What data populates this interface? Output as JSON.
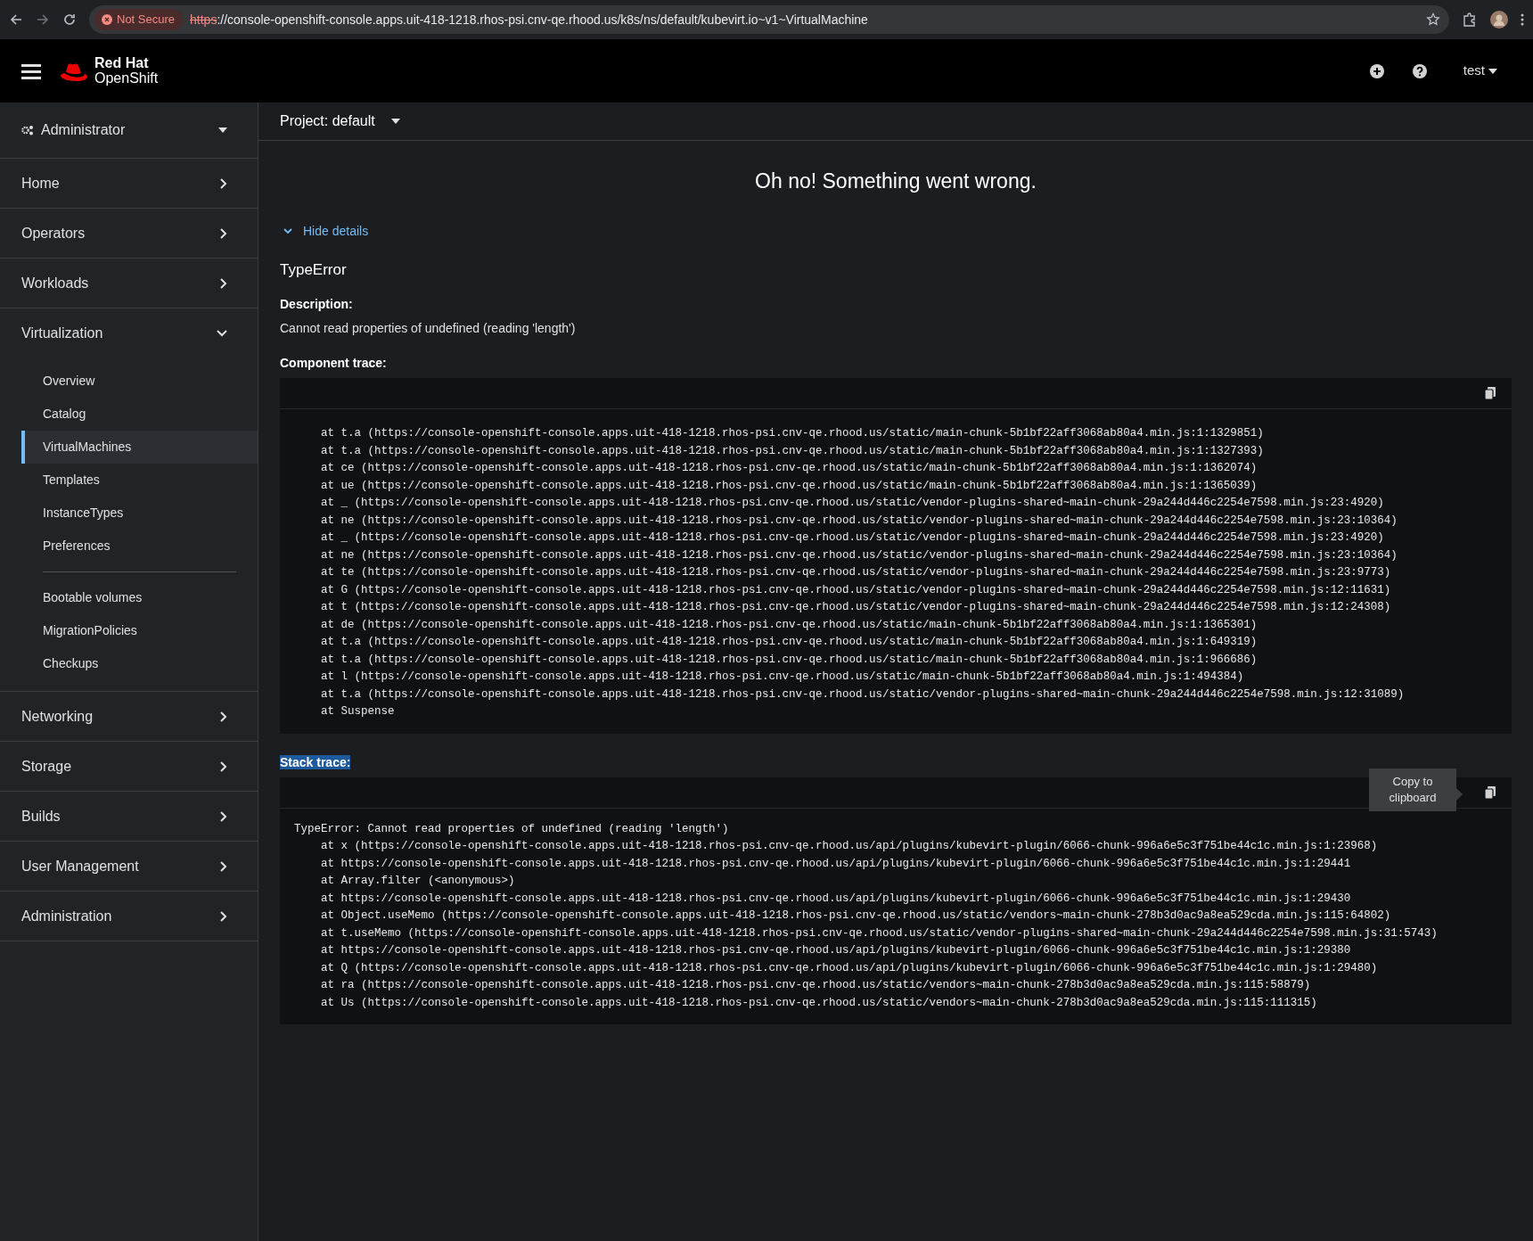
{
  "browser": {
    "security_badge": "Not Secure",
    "url_scheme": "https",
    "url_rest": "://console-openshift-console.apps.uit-418-1218.rhos-psi.cnv-qe.rhood.us/k8s/ns/default/kubevirt.io~v1~VirtualMachine"
  },
  "masthead": {
    "brand_top": "Red Hat",
    "brand_bottom": "OpenShift",
    "user": "test"
  },
  "sidebar": {
    "perspective": "Administrator",
    "sections": [
      {
        "label": "Home",
        "expanded": false
      },
      {
        "label": "Operators",
        "expanded": false
      },
      {
        "label": "Workloads",
        "expanded": false
      },
      {
        "label": "Virtualization",
        "expanded": true,
        "children": [
          {
            "label": "Overview",
            "selected": false,
            "divider_before": false
          },
          {
            "label": "Catalog",
            "selected": false,
            "divider_before": false
          },
          {
            "label": "VirtualMachines",
            "selected": true,
            "divider_before": false
          },
          {
            "label": "Templates",
            "selected": false,
            "divider_before": false
          },
          {
            "label": "InstanceTypes",
            "selected": false,
            "divider_before": false
          },
          {
            "label": "Preferences",
            "selected": false,
            "divider_before": false
          },
          {
            "label": "Bootable volumes",
            "selected": false,
            "divider_before": true
          },
          {
            "label": "MigrationPolicies",
            "selected": false,
            "divider_before": false
          },
          {
            "label": "Checkups",
            "selected": false,
            "divider_before": false
          }
        ]
      },
      {
        "label": "Networking",
        "expanded": false
      },
      {
        "label": "Storage",
        "expanded": false
      },
      {
        "label": "Builds",
        "expanded": false
      },
      {
        "label": "User Management",
        "expanded": false
      },
      {
        "label": "Administration",
        "expanded": false
      }
    ]
  },
  "project_bar": {
    "label": "Project: default"
  },
  "error": {
    "title": "Oh no! Something went wrong.",
    "details_toggle": "Hide details",
    "details_expanded": true,
    "name": "TypeError",
    "description_label": "Description:",
    "description": "Cannot read properties of undefined (reading 'length')",
    "component_trace": {
      "label": "Component trace:",
      "frames": [
        "at t.a (https://console-openshift-console.apps.uit-418-1218.rhos-psi.cnv-qe.rhood.us/static/main-chunk-5b1bf22aff3068ab80a4.min.js:1:1329851)",
        "at t.a (https://console-openshift-console.apps.uit-418-1218.rhos-psi.cnv-qe.rhood.us/static/main-chunk-5b1bf22aff3068ab80a4.min.js:1:1327393)",
        "at ce (https://console-openshift-console.apps.uit-418-1218.rhos-psi.cnv-qe.rhood.us/static/main-chunk-5b1bf22aff3068ab80a4.min.js:1:1362074)",
        "at ue (https://console-openshift-console.apps.uit-418-1218.rhos-psi.cnv-qe.rhood.us/static/main-chunk-5b1bf22aff3068ab80a4.min.js:1:1365039)",
        "at _ (https://console-openshift-console.apps.uit-418-1218.rhos-psi.cnv-qe.rhood.us/static/vendor-plugins-shared~main-chunk-29a244d446c2254e7598.min.js:23:4920)",
        "at ne (https://console-openshift-console.apps.uit-418-1218.rhos-psi.cnv-qe.rhood.us/static/vendor-plugins-shared~main-chunk-29a244d446c2254e7598.min.js:23:10364)",
        "at _ (https://console-openshift-console.apps.uit-418-1218.rhos-psi.cnv-qe.rhood.us/static/vendor-plugins-shared~main-chunk-29a244d446c2254e7598.min.js:23:4920)",
        "at ne (https://console-openshift-console.apps.uit-418-1218.rhos-psi.cnv-qe.rhood.us/static/vendor-plugins-shared~main-chunk-29a244d446c2254e7598.min.js:23:10364)",
        "at te (https://console-openshift-console.apps.uit-418-1218.rhos-psi.cnv-qe.rhood.us/static/vendor-plugins-shared~main-chunk-29a244d446c2254e7598.min.js:23:9773)",
        "at G (https://console-openshift-console.apps.uit-418-1218.rhos-psi.cnv-qe.rhood.us/static/vendor-plugins-shared~main-chunk-29a244d446c2254e7598.min.js:12:11631)",
        "at t (https://console-openshift-console.apps.uit-418-1218.rhos-psi.cnv-qe.rhood.us/static/vendor-plugins-shared~main-chunk-29a244d446c2254e7598.min.js:12:24308)",
        "at de (https://console-openshift-console.apps.uit-418-1218.rhos-psi.cnv-qe.rhood.us/static/main-chunk-5b1bf22aff3068ab80a4.min.js:1:1365301)",
        "at t.a (https://console-openshift-console.apps.uit-418-1218.rhos-psi.cnv-qe.rhood.us/static/main-chunk-5b1bf22aff3068ab80a4.min.js:1:649319)",
        "at t.a (https://console-openshift-console.apps.uit-418-1218.rhos-psi.cnv-qe.rhood.us/static/main-chunk-5b1bf22aff3068ab80a4.min.js:1:966686)",
        "at l (https://console-openshift-console.apps.uit-418-1218.rhos-psi.cnv-qe.rhood.us/static/main-chunk-5b1bf22aff3068ab80a4.min.js:1:494384)",
        "at t.a (https://console-openshift-console.apps.uit-418-1218.rhos-psi.cnv-qe.rhood.us/static/vendor-plugins-shared~main-chunk-29a244d446c2254e7598.min.js:12:31089)",
        "at Suspense"
      ]
    },
    "stack_trace": {
      "label": "Stack trace:",
      "label_highlighted": true,
      "message": "TypeError: Cannot read properties of undefined (reading 'length')",
      "tooltip": "Copy to clipboard",
      "frames": [
        "at x (https://console-openshift-console.apps.uit-418-1218.rhos-psi.cnv-qe.rhood.us/api/plugins/kubevirt-plugin/6066-chunk-996a6e5c3f751be44c1c.min.js:1:23968)",
        "at https://console-openshift-console.apps.uit-418-1218.rhos-psi.cnv-qe.rhood.us/api/plugins/kubevirt-plugin/6066-chunk-996a6e5c3f751be44c1c.min.js:1:29441",
        "at Array.filter (<anonymous>)",
        "at https://console-openshift-console.apps.uit-418-1218.rhos-psi.cnv-qe.rhood.us/api/plugins/kubevirt-plugin/6066-chunk-996a6e5c3f751be44c1c.min.js:1:29430",
        "at Object.useMemo (https://console-openshift-console.apps.uit-418-1218.rhos-psi.cnv-qe.rhood.us/static/vendors~main-chunk-278b3d0ac9a8ea529cda.min.js:115:64802)",
        "at t.useMemo (https://console-openshift-console.apps.uit-418-1218.rhos-psi.cnv-qe.rhood.us/static/vendor-plugins-shared~main-chunk-29a244d446c2254e7598.min.js:31:5743)",
        "at https://console-openshift-console.apps.uit-418-1218.rhos-psi.cnv-qe.rhood.us/api/plugins/kubevirt-plugin/6066-chunk-996a6e5c3f751be44c1c.min.js:1:29380",
        "at Q (https://console-openshift-console.apps.uit-418-1218.rhos-psi.cnv-qe.rhood.us/api/plugins/kubevirt-plugin/6066-chunk-996a6e5c3f751be44c1c.min.js:1:29480)",
        "at ra (https://console-openshift-console.apps.uit-418-1218.rhos-psi.cnv-qe.rhood.us/static/vendors~main-chunk-278b3d0ac9a8ea529cda.min.js:115:58879)",
        "at Us (https://console-openshift-console.apps.uit-418-1218.rhos-psi.cnv-qe.rhood.us/static/vendors~main-chunk-278b3d0ac9a8ea529cda.min.js:115:111315)"
      ]
    }
  }
}
